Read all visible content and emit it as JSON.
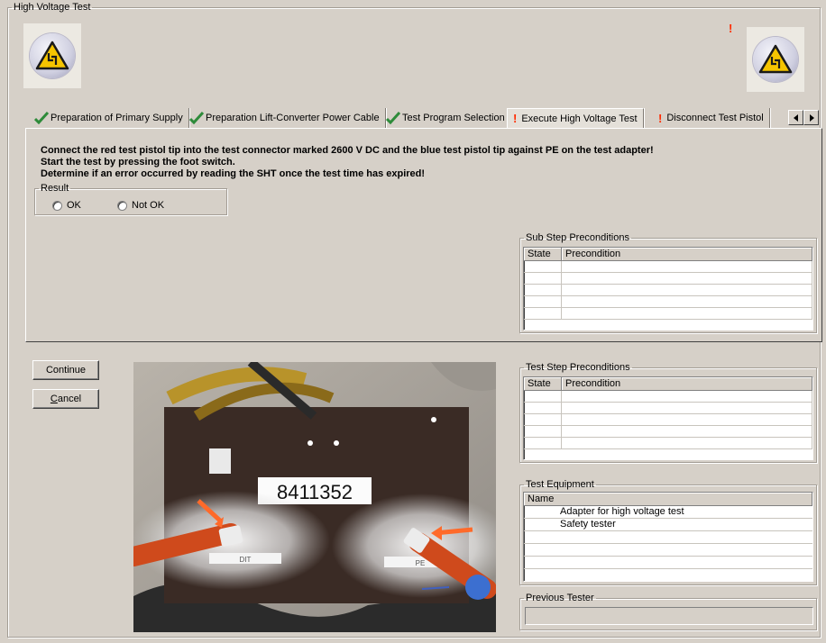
{
  "window": {
    "title": "High Voltage Test"
  },
  "header": {
    "warning_mark": "!"
  },
  "tabs": [
    {
      "label": "Preparation of Primary Supply",
      "status": "done"
    },
    {
      "label": "Preparation Lift-Converter Power Cable",
      "status": "done"
    },
    {
      "label": "Test Program Selection",
      "status": "done"
    },
    {
      "label": "Execute High Voltage Test",
      "status": "warning",
      "active": true,
      "mark": "!"
    },
    {
      "label": "Disconnect Test Pistol",
      "status": "warning",
      "mark": "!"
    }
  ],
  "instructions": [
    "Connect the red test pistol tip into the test connector marked 2600 V DC and the blue test pistol tip against PE on the test adapter!",
    "Start the test by pressing the foot switch.",
    "Determine if an error occurred by reading the SHT once the test time has expired!"
  ],
  "result": {
    "legend": "Result",
    "options": [
      "OK",
      "Not OK"
    ]
  },
  "sub_step_preconditions": {
    "legend": "Sub Step Preconditions",
    "columns": [
      "State",
      "Precondition"
    ]
  },
  "test_step_preconditions": {
    "legend": "Test Step Preconditions",
    "columns": [
      "State",
      "Precondition"
    ]
  },
  "test_equipment": {
    "legend": "Test Equipment",
    "columns": [
      "Name"
    ],
    "rows": [
      "Adapter for high voltage test",
      "Safety tester"
    ]
  },
  "previous_tester": {
    "legend": "Previous Tester",
    "value": ""
  },
  "buttons": {
    "continue": "Continue",
    "cancel_accel": "C",
    "cancel_rest": "ancel"
  },
  "photo": {
    "serial": "8411352",
    "label_left": "DIT",
    "label_right": "PE"
  },
  "colors": {
    "warning": "#ff2a00",
    "check": "#2e8b3a",
    "panel": "#d6d0c8"
  }
}
